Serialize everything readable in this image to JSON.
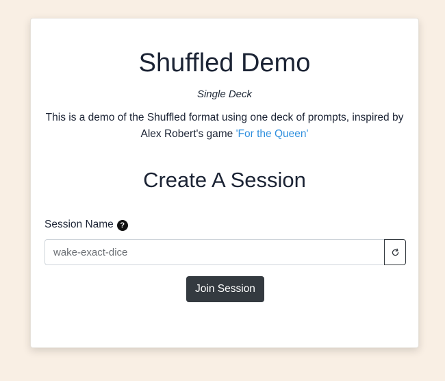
{
  "page": {
    "title": "Shuffled Demo",
    "subtitle": "Single Deck",
    "description_text": "This is a demo of the Shuffled format using one deck of prompts, inspired by Alex Robert's game ",
    "description_link": "'For the Queen'"
  },
  "form": {
    "heading": "Create A Session",
    "session_label": "Session Name",
    "help_glyph": "?",
    "session_value": "wake-exact-dice",
    "join_label": "Join Session"
  },
  "icons": {
    "help": "question-circle-icon",
    "refresh": "refresh-icon"
  },
  "colors": {
    "background": "#f9efe4",
    "link": "#2f8fde",
    "button_dark": "#343a40"
  }
}
